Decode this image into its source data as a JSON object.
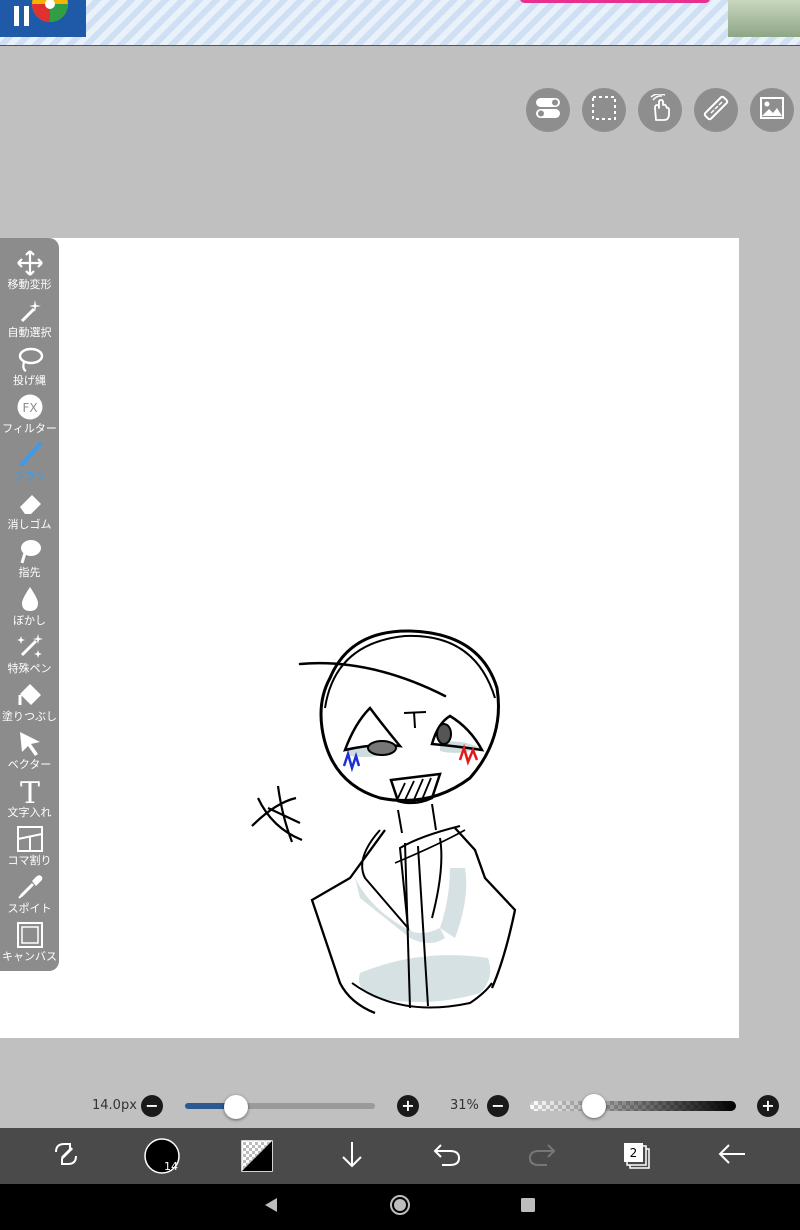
{
  "toolbar": {
    "items": [
      {
        "label": "移動変形",
        "icon": "move-icon"
      },
      {
        "label": "自動選択",
        "icon": "magic-wand-icon"
      },
      {
        "label": "投げ縄",
        "icon": "lasso-icon"
      },
      {
        "label": "フィルター",
        "icon": "fx-icon",
        "icon_text": "FX"
      },
      {
        "label": "ブラシ",
        "icon": "brush-icon",
        "active": true
      },
      {
        "label": "消しゴム",
        "icon": "eraser-icon"
      },
      {
        "label": "指先",
        "icon": "finger-icon"
      },
      {
        "label": "ぼかし",
        "icon": "blur-drop-icon"
      },
      {
        "label": "特殊ペン",
        "icon": "special-pen-icon"
      },
      {
        "label": "塗りつぶし",
        "icon": "fill-bucket-icon"
      },
      {
        "label": "ベクター",
        "icon": "vector-cursor-icon"
      },
      {
        "label": "文字入れ",
        "icon": "text-icon",
        "icon_text": "T"
      },
      {
        "label": "コマ割り",
        "icon": "frame-divider-icon"
      },
      {
        "label": "スポイト",
        "icon": "eyedropper-icon"
      },
      {
        "label": "キャンバス",
        "icon": "canvas-icon"
      }
    ]
  },
  "brush": {
    "size_label": "14.0px",
    "size_fraction": 0.27,
    "opacity_label": "31%",
    "opacity_fraction": 0.31,
    "minus": "−",
    "plus": "+"
  },
  "action_bar": {
    "brush_size_badge": "14",
    "layer_count": "2"
  },
  "colors": {
    "accent": "#3d9be9",
    "toolbar_bg": "#8c8c8c",
    "action_bar_bg": "#4a4a4a",
    "workspace_bg": "#c0c0c0"
  }
}
